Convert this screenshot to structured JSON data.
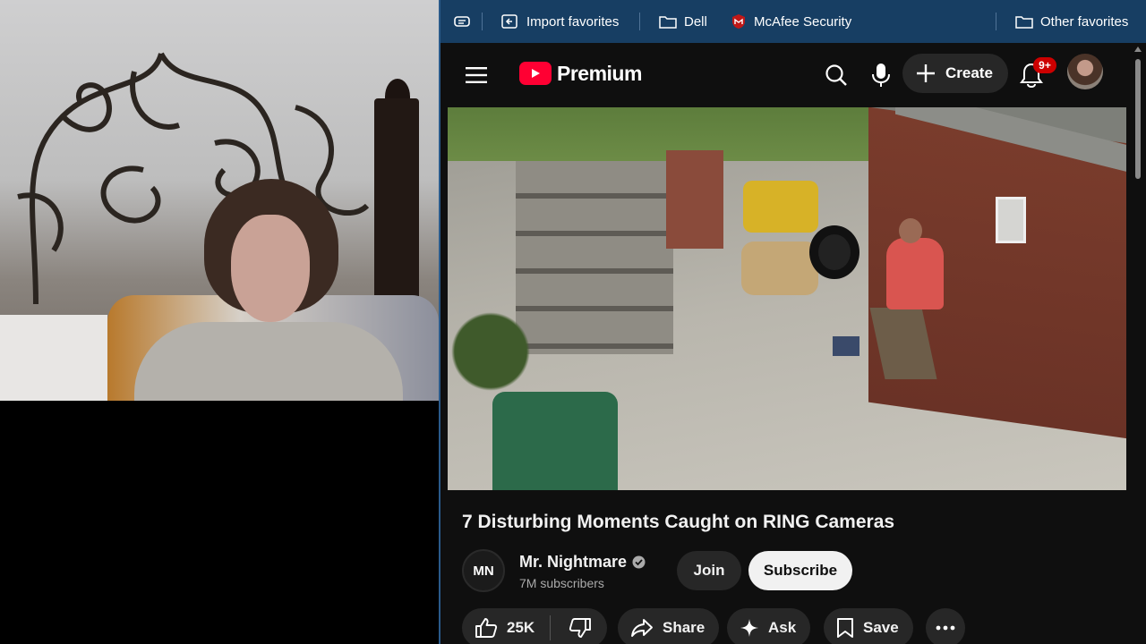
{
  "favorites_bar": {
    "items": [
      {
        "label": "Import favorites",
        "icon": "import-icon"
      },
      {
        "label": "Dell",
        "icon": "folder-icon"
      },
      {
        "label": "McAfee Security",
        "icon": "mcafee-shield-icon"
      }
    ],
    "other_label": "Other favorites"
  },
  "masthead": {
    "logo_text": "Premium",
    "create_label": "Create",
    "notification_badge": "9+"
  },
  "video": {
    "title": "7 Disturbing Moments Caught on RING Cameras"
  },
  "channel": {
    "name": "Mr. Nightmare",
    "avatar_text": "MN",
    "subscribers": "7M subscribers",
    "join_label": "Join",
    "subscribe_label": "Subscribe"
  },
  "actions": {
    "like_count": "25K",
    "share_label": "Share",
    "ask_label": "Ask",
    "save_label": "Save"
  },
  "colors": {
    "brand_red": "#ff0033",
    "favbar_bg": "#173e63",
    "page_bg": "#0f0f0f",
    "pill_bg": "#272727"
  }
}
